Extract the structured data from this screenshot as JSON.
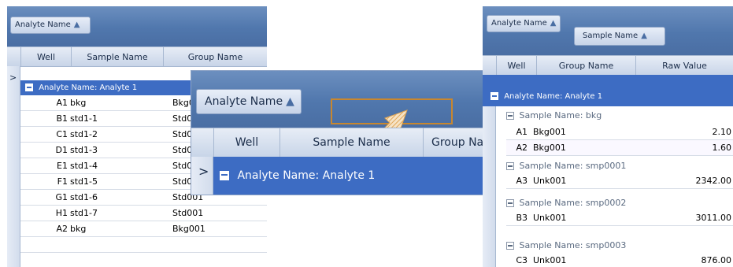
{
  "left_panel": {
    "group_chip": "Analyte Name",
    "columns": [
      "Well",
      "Sample Name",
      "Group Name"
    ],
    "group_row": "Analyte Name: Analyte 1",
    "rows": [
      {
        "well": "A1",
        "sample": "bkg",
        "group": "Bkg0"
      },
      {
        "well": "B1",
        "sample": "std1-1",
        "group": "Std0"
      },
      {
        "well": "C1",
        "sample": "std1-2",
        "group": "Std0"
      },
      {
        "well": "D1",
        "sample": "std1-3",
        "group": "Std0"
      },
      {
        "well": "E1",
        "sample": "std1-4",
        "group": "Std0"
      },
      {
        "well": "F1",
        "sample": "std1-5",
        "group": "Std001"
      },
      {
        "well": "G1",
        "sample": "std1-6",
        "group": "Std001"
      },
      {
        "well": "H1",
        "sample": "std1-7",
        "group": "Std001"
      },
      {
        "well": "A2",
        "sample": "bkg",
        "group": "Bkg001"
      }
    ]
  },
  "zoom_panel": {
    "group_chip": "Analyte Name",
    "columns": [
      "Well",
      "Sample Name",
      "Group Na"
    ],
    "group_row": "Analyte Name: Analyte 1"
  },
  "right_panel": {
    "group_chips": [
      "Analyte Name",
      "Sample Name"
    ],
    "columns": [
      "Well",
      "Group Name",
      "Raw Value"
    ],
    "group_row": "Analyte Name: Analyte 1",
    "subgroups": [
      {
        "label": "Sample Name: bkg",
        "rows": [
          {
            "well": "A1",
            "group": "Bkg001",
            "value": "2.10"
          },
          {
            "well": "A2",
            "group": "Bkg001",
            "value": "1.60"
          }
        ]
      },
      {
        "label": "Sample Name: smp0001",
        "rows": [
          {
            "well": "A3",
            "group": "Unk001",
            "value": "2342.00"
          }
        ]
      },
      {
        "label": "Sample Name: smp0002",
        "rows": [
          {
            "well": "B3",
            "group": "Unk001",
            "value": "3011.00"
          }
        ]
      },
      {
        "label": "Sample Name: smp0003",
        "rows": [
          {
            "well": "C3",
            "group": "Unk001",
            "value": "876.00"
          }
        ]
      }
    ]
  },
  "sort_arrow": "▲",
  "colors": {
    "group_bar": "#5077ad",
    "group_row": "#3d6cc3",
    "drag_target": "#c8872f"
  }
}
